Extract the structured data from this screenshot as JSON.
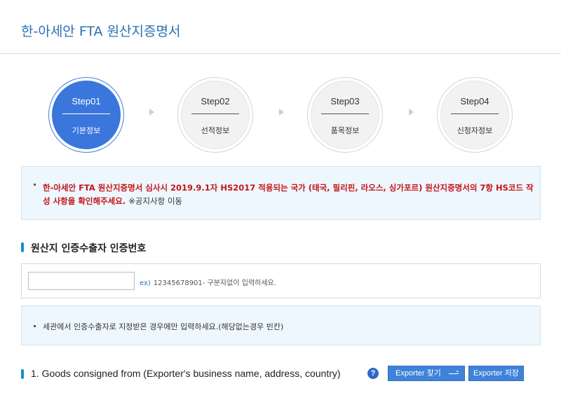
{
  "page": {
    "title": "한-아세안 FTA 원산지증명서"
  },
  "steps": [
    {
      "num": "Step01",
      "label": "기본정보",
      "active": true
    },
    {
      "num": "Step02",
      "label": "선적정보",
      "active": false
    },
    {
      "num": "Step03",
      "label": "품목정보",
      "active": false
    },
    {
      "num": "Step04",
      "label": "신청자정보",
      "active": false
    }
  ],
  "notice": {
    "text": "한-아세안 FTA 원산지증명서 심사시 2019.9.1자 HS2017 적용되는 국가 (태국, 필리핀, 라오스, 싱가포르) 원산지증명서의 7항 HS코드 작성 사항을 확인해주세요.",
    "link": "※공지사항 이동"
  },
  "exporter_cert": {
    "heading": "원산지 인증수출자 인증번호",
    "input_value": "",
    "hint_prefix": "ex)",
    "hint_text": "12345678901- 구분자없이 입력하세요.",
    "info": "세관에서 인증수출자로 지정받은 경우에만 입력하세요.(해당없는경우 빈칸)"
  },
  "goods": {
    "heading": "1. Goods consigned from (Exporter's business name, address, country)",
    "help_icon": "?",
    "find_button": "Exporter 찾기",
    "save_button": "Exporter 저장"
  },
  "colors": {
    "accent": "#3a76db",
    "title": "#2a6fb5",
    "notice_bg": "#eef7fd",
    "notice_text": "#c4141b",
    "section_bar": "#1a8ad6"
  }
}
